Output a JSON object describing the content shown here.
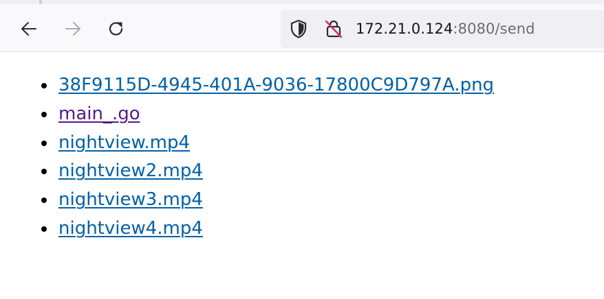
{
  "browser": {
    "url_host": "172.21.0.124",
    "url_rest": ":8080/send",
    "icons": {
      "back": "back-arrow-icon",
      "forward": "forward-arrow-icon",
      "reload": "reload-icon",
      "shield": "tracking-protection-shield-icon",
      "lock": "insecure-lock-icon"
    }
  },
  "files": [
    {
      "name": "38F9115D-4945-401A-9036-17800C9D797A.png",
      "visited": false
    },
    {
      "name": "main_.go",
      "visited": true
    },
    {
      "name": "nightview.mp4",
      "visited": false
    },
    {
      "name": "nightview2.mp4",
      "visited": false
    },
    {
      "name": "nightview3.mp4",
      "visited": false
    },
    {
      "name": "nightview4.mp4",
      "visited": false
    }
  ],
  "colors": {
    "link": "#0060a8",
    "visited_link": "#551a8b",
    "toolbar_bg": "#f9f9fb",
    "urlbar_bg": "#f0f0f4"
  }
}
